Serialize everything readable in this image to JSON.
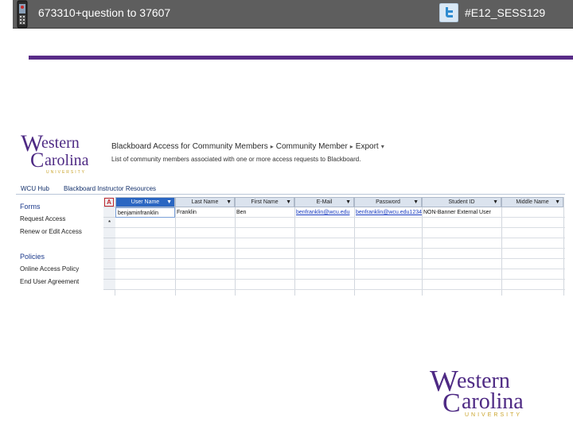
{
  "header": {
    "sms_text": "673310+question to 37607",
    "hashtag": "#E12_SESS129"
  },
  "logo": {
    "word1": "estern",
    "word2": "arolina",
    "university": "UNIVERSITY",
    "color": "#4e2a84"
  },
  "screenshot": {
    "breadcrumb": [
      "Blackboard Access for Community Members",
      "Community Member",
      "Export"
    ],
    "subtitle": "List of community members associated with one or more access requests to Blackboard.",
    "tabs": [
      "WCU Hub",
      "Blackboard Instructor Resources"
    ],
    "sidebar": {
      "forms_heading": "Forms",
      "forms_links": [
        "Request Access",
        "Renew or Edit Access"
      ],
      "policies_heading": "Policies",
      "policies_links": [
        "Online Access Policy",
        "End User Agreement"
      ]
    },
    "grid": {
      "corner_label": "A",
      "columns": [
        "User Name",
        "Last Name",
        "First Name",
        "E-Mail",
        "Password",
        "Student ID",
        "Middle Name"
      ],
      "rows": [
        [
          "benjaminfranklin",
          "Franklin",
          "Ben",
          "benfranklin@wcu.edu",
          "benfranklin@wcu.edu1234",
          "NON-Banner External User",
          ""
        ]
      ],
      "new_row_marker": "*"
    }
  },
  "colors": {
    "accent_purple": "#592c88",
    "topbar": "#5e5e5e",
    "selected_header": "#2a66c2"
  }
}
